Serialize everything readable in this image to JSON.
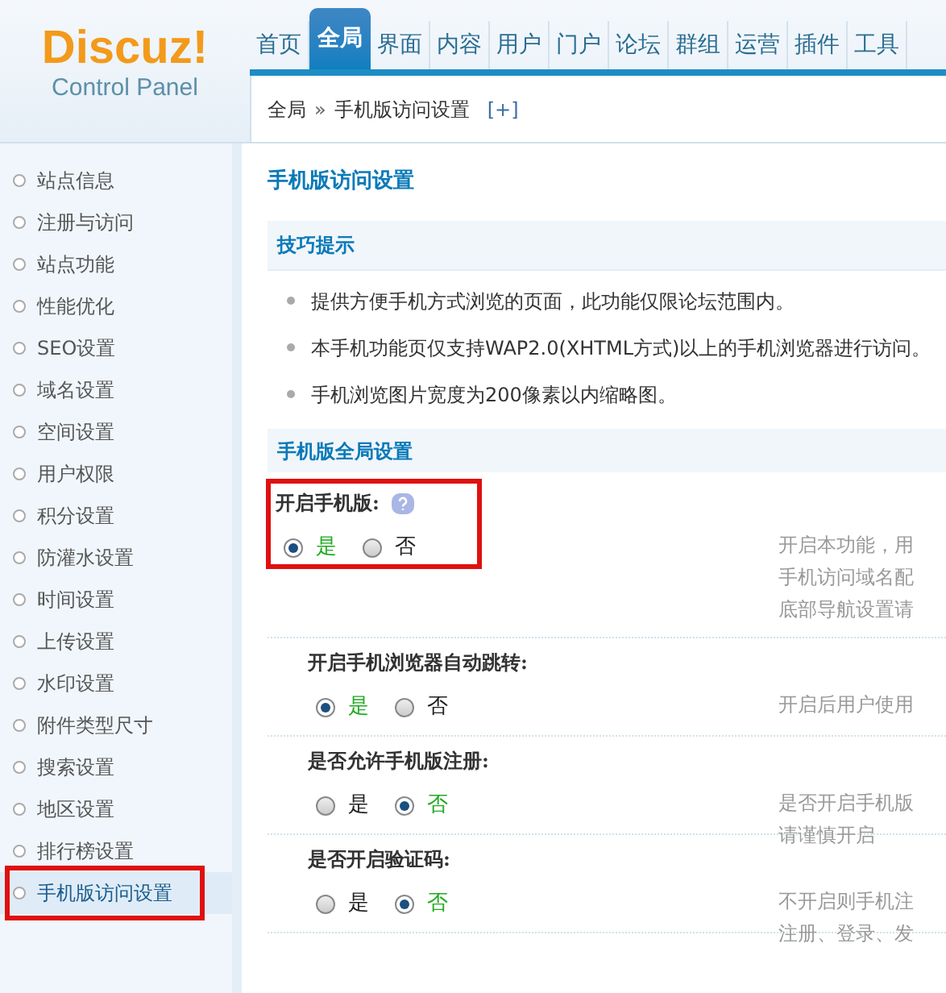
{
  "logo": {
    "title": "Discuz!",
    "subtitle": "Control Panel"
  },
  "nav": [
    {
      "label": "首页",
      "selected": false
    },
    {
      "label": "全局",
      "selected": true
    },
    {
      "label": "界面",
      "selected": false
    },
    {
      "label": "内容",
      "selected": false
    },
    {
      "label": "用户",
      "selected": false
    },
    {
      "label": "门户",
      "selected": false
    },
    {
      "label": "论坛",
      "selected": false
    },
    {
      "label": "群组",
      "selected": false
    },
    {
      "label": "运营",
      "selected": false
    },
    {
      "label": "插件",
      "selected": false
    },
    {
      "label": "工具",
      "selected": false
    }
  ],
  "breadcrumb": {
    "root": "全局",
    "separator": "»",
    "current": "手机版访问设置",
    "add": "[+]"
  },
  "sidebar": {
    "items": [
      {
        "label": "站点信息",
        "selected": false,
        "highlighted": false
      },
      {
        "label": "注册与访问",
        "selected": false,
        "highlighted": false
      },
      {
        "label": "站点功能",
        "selected": false,
        "highlighted": false
      },
      {
        "label": "性能优化",
        "selected": false,
        "highlighted": false
      },
      {
        "label": "SEO设置",
        "selected": false,
        "highlighted": false
      },
      {
        "label": "域名设置",
        "selected": false,
        "highlighted": false
      },
      {
        "label": "空间设置",
        "selected": false,
        "highlighted": false
      },
      {
        "label": "用户权限",
        "selected": false,
        "highlighted": false
      },
      {
        "label": "积分设置",
        "selected": false,
        "highlighted": false
      },
      {
        "label": "防灌水设置",
        "selected": false,
        "highlighted": false
      },
      {
        "label": "时间设置",
        "selected": false,
        "highlighted": false
      },
      {
        "label": "上传设置",
        "selected": false,
        "highlighted": false
      },
      {
        "label": "水印设置",
        "selected": false,
        "highlighted": false
      },
      {
        "label": "附件类型尺寸",
        "selected": false,
        "highlighted": false
      },
      {
        "label": "搜索设置",
        "selected": false,
        "highlighted": false
      },
      {
        "label": "地区设置",
        "selected": false,
        "highlighted": false
      },
      {
        "label": "排行榜设置",
        "selected": false,
        "highlighted": false
      },
      {
        "label": "手机版访问设置",
        "selected": true,
        "highlighted": true
      }
    ]
  },
  "page_title": "手机版访问设置",
  "tips": {
    "title": "技巧提示",
    "items": [
      "提供方便手机方式浏览的页面，此功能仅限论坛范围内。",
      "本手机功能页仅支持WAP2.0(XHTML方式)以上的手机浏览器进行访问。",
      "手机浏览图片宽度为200像素以内缩略图。"
    ]
  },
  "settings": {
    "title": "手机版全局设置",
    "rows": [
      {
        "label": "开启手机版:",
        "help": true,
        "highlighted": true,
        "options": [
          {
            "label": "是",
            "selected": true
          },
          {
            "label": "否",
            "selected": false
          }
        ],
        "description": [
          "开启本功能，用",
          "手机访问域名配",
          "底部导航设置请"
        ]
      },
      {
        "label": "开启手机浏览器自动跳转:",
        "help": false,
        "highlighted": false,
        "options": [
          {
            "label": "是",
            "selected": true
          },
          {
            "label": "否",
            "selected": false
          }
        ],
        "description": [
          "开启后用户使用"
        ]
      },
      {
        "label": "是否允许手机版注册:",
        "help": false,
        "highlighted": false,
        "options": [
          {
            "label": "是",
            "selected": false
          },
          {
            "label": "否",
            "selected": true
          }
        ],
        "description": [
          "是否开启手机版",
          "请谨慎开启"
        ]
      },
      {
        "label": "是否开启验证码:",
        "help": false,
        "highlighted": false,
        "options": [
          {
            "label": "是",
            "selected": false
          },
          {
            "label": "否",
            "selected": true
          }
        ],
        "description": [
          "不开启则手机注",
          "注册、登录、发"
        ]
      }
    ]
  }
}
